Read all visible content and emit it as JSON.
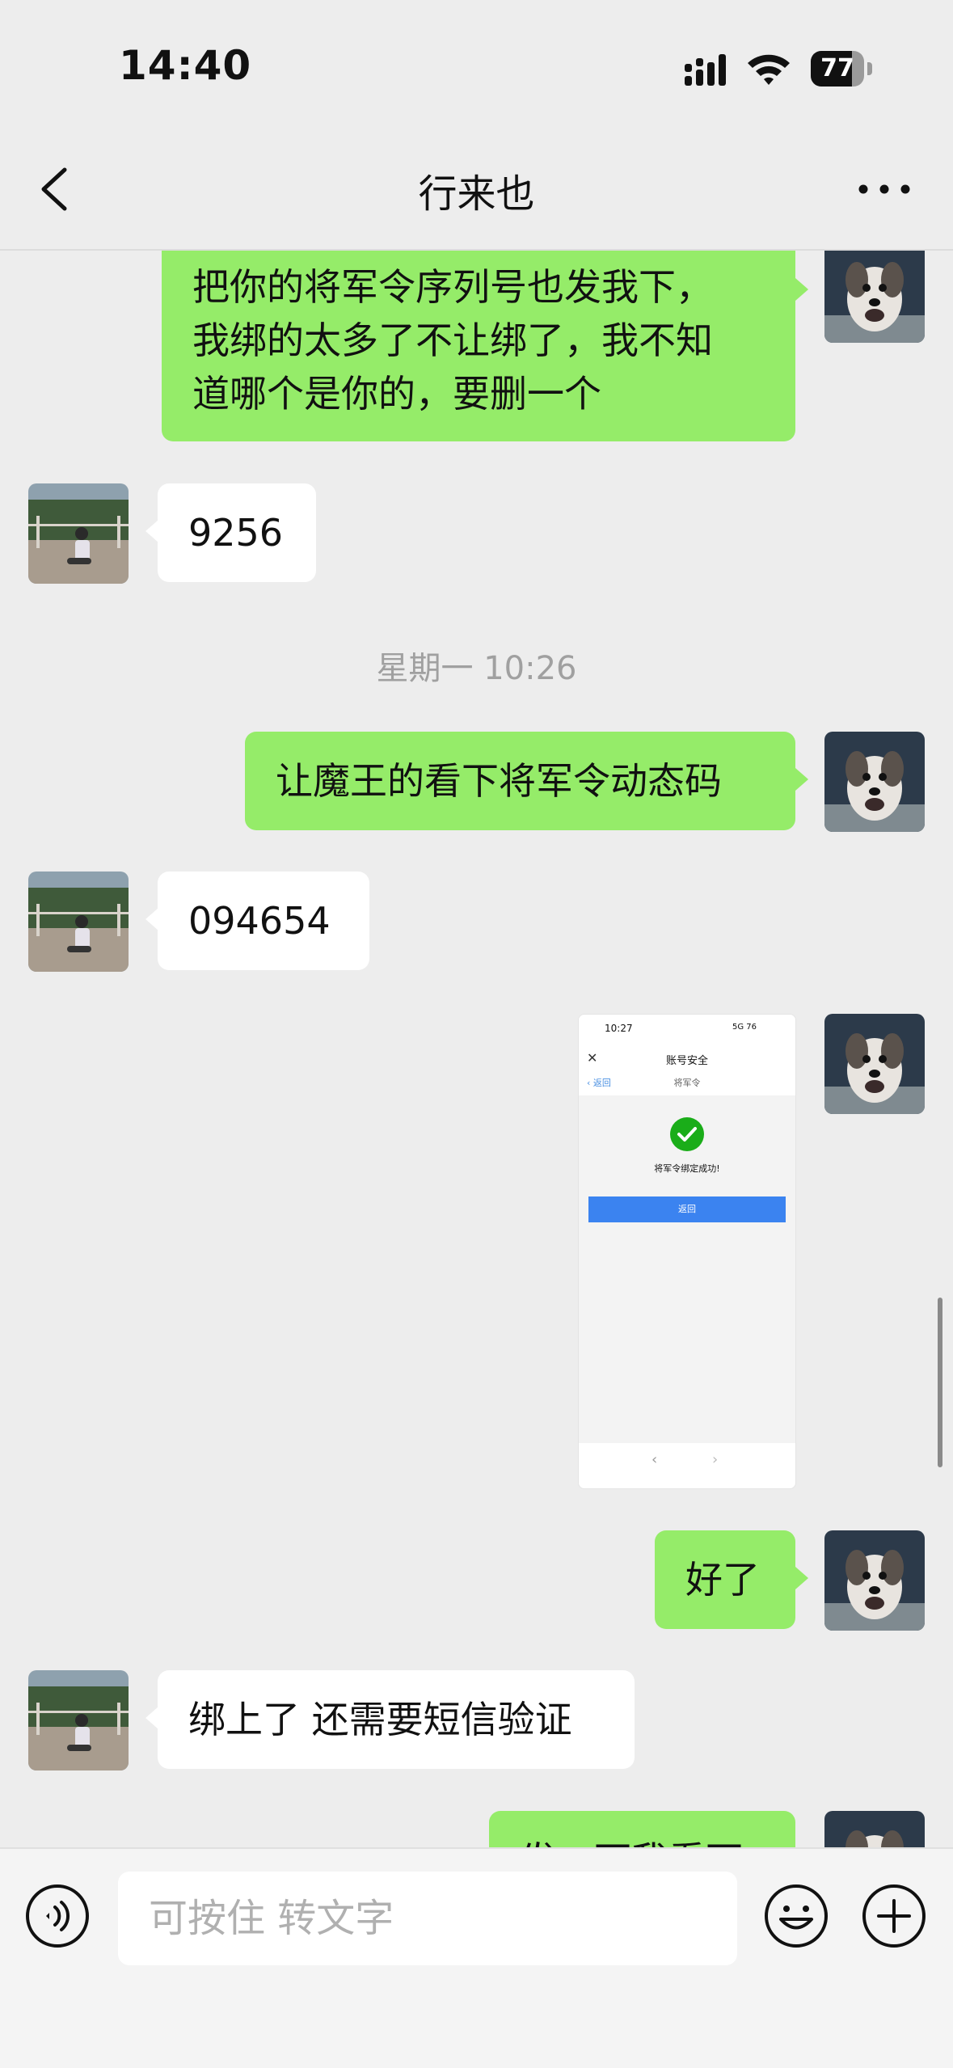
{
  "status": {
    "time": "14:40",
    "battery": "77",
    "battery_level": 0.77
  },
  "nav": {
    "title": "行来也",
    "back_icon": "chevron-left-icon",
    "more_icon": "more-dots-icon"
  },
  "messages": [
    {
      "from": "me",
      "text": "把你的将军令序列号也发我下，\n我绑的太多了不让绑了，我不知\n道哪个是你的，要删一个"
    },
    {
      "from": "them",
      "text": "9256"
    },
    {
      "type": "timestamp",
      "text": "星期一 10:26"
    },
    {
      "from": "me",
      "text": "让魔王的看下将军令动态码"
    },
    {
      "from": "them",
      "text": "094654"
    },
    {
      "from": "me",
      "type": "image"
    },
    {
      "from": "me",
      "text": "好了"
    },
    {
      "from": "them",
      "text": "绑上了 还需要短信验证"
    },
    {
      "from": "me",
      "text": "发一下我看下"
    }
  ],
  "screenshot": {
    "time": "10:27",
    "status": "5G 76",
    "title": "账号安全",
    "back": "返回",
    "subtitle": "将军令",
    "message": "将军令绑定成功!",
    "button": "返回"
  },
  "input": {
    "placeholder": "可按住 转文字"
  },
  "colors": {
    "my_bubble": "#95ec69",
    "their_bubble": "#ffffff",
    "background": "#ededed"
  },
  "icons": {
    "voice": "voice-icon",
    "emoji": "emoji-icon",
    "plus": "plus-icon"
  }
}
